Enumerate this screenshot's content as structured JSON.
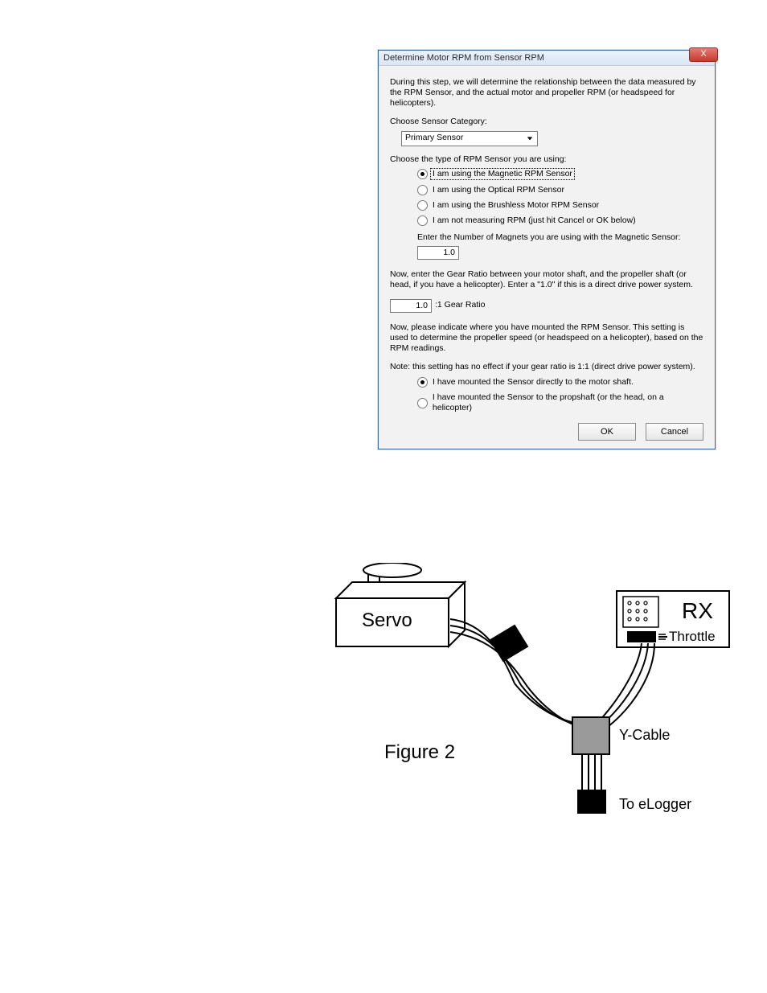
{
  "dialog": {
    "title": "Determine Motor RPM from Sensor RPM",
    "close": "X",
    "intro": "During this step, we will determine the relationship between the data measured by the RPM Sensor, and the actual motor and propeller RPM (or headspeed for helicopters).",
    "sensor_category_label": "Choose Sensor Category:",
    "sensor_category_value": "Primary Sensor",
    "sensor_type_label": "Choose the type of RPM Sensor you are using:",
    "sensor_types": {
      "magnetic": "I am using the Magnetic RPM Sensor",
      "optical": "I am using the Optical RPM Sensor",
      "brushless": "I am using the Brushless Motor RPM Sensor",
      "none": "I am not measuring RPM (just hit Cancel or OK below)"
    },
    "magnets_label": "Enter the Number of Magnets you are using with the Magnetic Sensor:",
    "magnets_value": "1.0",
    "gear_ratio_intro": "Now, enter the Gear Ratio between your motor shaft, and the propeller shaft (or head, if you have a helicopter).    Enter a \"1.0\" if this is a direct drive power system.",
    "gear_ratio_value": "1.0",
    "gear_ratio_suffix": ":1 Gear Ratio",
    "mount_intro": "Now, please indicate where you have mounted the RPM Sensor.   This setting is used to determine the propeller speed (or headspeed on a helicopter), based on the RPM readings.",
    "mount_note": "Note: this setting has no effect if your gear ratio is 1:1 (direct drive power system).",
    "mount_options": {
      "motor_shaft": "I have mounted the Sensor directly to the motor shaft.",
      "propshaft": "I have mounted the Sensor to the propshaft (or the head, on a helicopter)"
    },
    "ok": "OK",
    "cancel": "Cancel"
  },
  "figure": {
    "caption": "Figure 2",
    "servo_label": "Servo",
    "rx_label": "RX",
    "rx_port_label": "Throttle",
    "ycable_label": "Y-Cable",
    "to_elogger_label": "To eLogger"
  }
}
